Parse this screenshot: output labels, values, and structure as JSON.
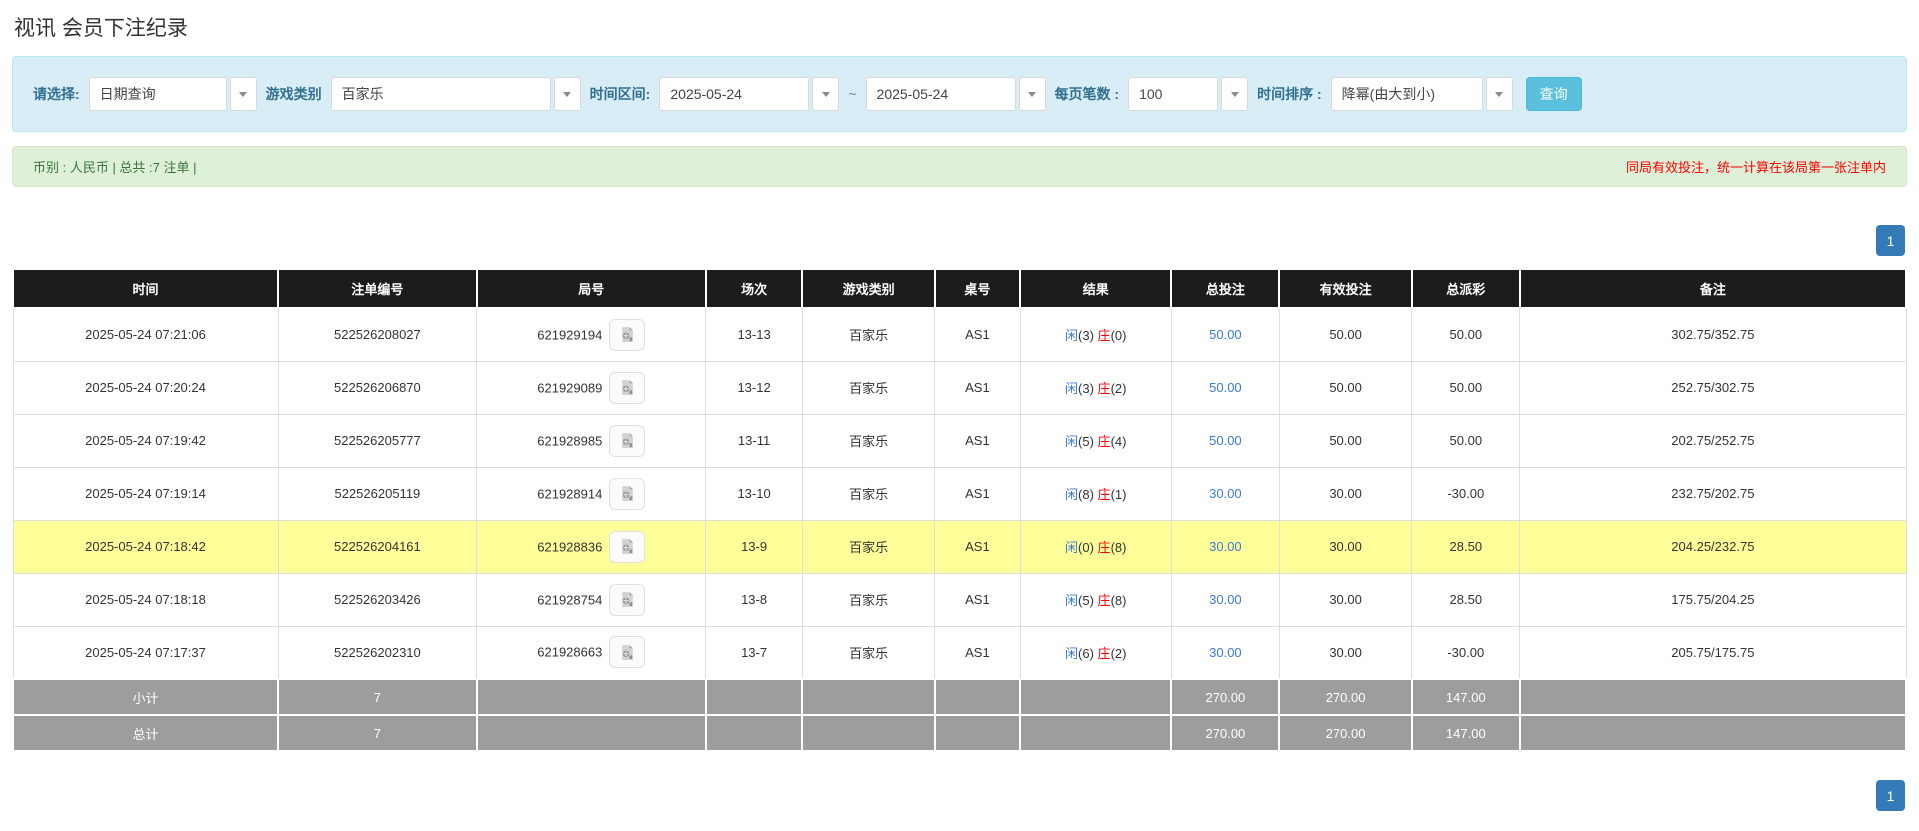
{
  "page": {
    "title": "视讯 会员下注纪录"
  },
  "filters": {
    "query_type": {
      "label": "请选择:",
      "value": "日期查询"
    },
    "game_category": {
      "label": "游戏类别",
      "value": "百家乐"
    },
    "date_range": {
      "label": "时间区间:",
      "from": "2025-05-24",
      "separator": "~",
      "to": "2025-05-24"
    },
    "page_size": {
      "label": "每页笔数 :",
      "value": "100"
    },
    "time_sort": {
      "label": "时间排序 :",
      "value": "降幂(由大到小)"
    },
    "query_button": "查询"
  },
  "summary": {
    "left_text": "币别 : 人民币 | 总共 :7 注单 |",
    "notice": "同局有效投注，统一计算在该局第一张注单内"
  },
  "pagination": {
    "current": "1"
  },
  "table": {
    "headers": [
      "时间",
      "注单编号",
      "局号",
      "场次",
      "游戏类别",
      "桌号",
      "结果",
      "总投注",
      "有效投注",
      "总派彩",
      "备注"
    ],
    "result_labels": {
      "player": "闲",
      "banker": "庄"
    },
    "rows": [
      {
        "time": "2025-05-24 07:21:06",
        "bet_no": "522526208027",
        "round_no": "621929194",
        "session": "13-13",
        "game": "百家乐",
        "table_no": "AS1",
        "player": "3",
        "banker": "0",
        "total_bet": "50.00",
        "valid_bet": "50.00",
        "payout": "50.00",
        "remark": "302.75/352.75",
        "highlighted": false
      },
      {
        "time": "2025-05-24 07:20:24",
        "bet_no": "522526206870",
        "round_no": "621929089",
        "session": "13-12",
        "game": "百家乐",
        "table_no": "AS1",
        "player": "3",
        "banker": "2",
        "total_bet": "50.00",
        "valid_bet": "50.00",
        "payout": "50.00",
        "remark": "252.75/302.75",
        "highlighted": false
      },
      {
        "time": "2025-05-24 07:19:42",
        "bet_no": "522526205777",
        "round_no": "621928985",
        "session": "13-11",
        "game": "百家乐",
        "table_no": "AS1",
        "player": "5",
        "banker": "4",
        "total_bet": "50.00",
        "valid_bet": "50.00",
        "payout": "50.00",
        "remark": "202.75/252.75",
        "highlighted": false
      },
      {
        "time": "2025-05-24 07:19:14",
        "bet_no": "522526205119",
        "round_no": "621928914",
        "session": "13-10",
        "game": "百家乐",
        "table_no": "AS1",
        "player": "8",
        "banker": "1",
        "total_bet": "30.00",
        "valid_bet": "30.00",
        "payout": "-30.00",
        "remark": "232.75/202.75",
        "highlighted": false
      },
      {
        "time": "2025-05-24 07:18:42",
        "bet_no": "522526204161",
        "round_no": "621928836",
        "session": "13-9",
        "game": "百家乐",
        "table_no": "AS1",
        "player": "0",
        "banker": "8",
        "total_bet": "30.00",
        "valid_bet": "30.00",
        "payout": "28.50",
        "remark": "204.25/232.75",
        "highlighted": true
      },
      {
        "time": "2025-05-24 07:18:18",
        "bet_no": "522526203426",
        "round_no": "621928754",
        "session": "13-8",
        "game": "百家乐",
        "table_no": "AS1",
        "player": "5",
        "banker": "8",
        "total_bet": "30.00",
        "valid_bet": "30.00",
        "payout": "28.50",
        "remark": "175.75/204.25",
        "highlighted": false
      },
      {
        "time": "2025-05-24 07:17:37",
        "bet_no": "522526202310",
        "round_no": "621928663",
        "session": "13-7",
        "game": "百家乐",
        "table_no": "AS1",
        "player": "6",
        "banker": "2",
        "total_bet": "30.00",
        "valid_bet": "30.00",
        "payout": "-30.00",
        "remark": "205.75/175.75",
        "highlighted": false
      }
    ],
    "footer_rows": [
      {
        "label": "小计",
        "count": "7",
        "total_bet": "270.00",
        "valid_bet": "270.00",
        "payout": "147.00"
      },
      {
        "label": "总计",
        "count": "7",
        "total_bet": "270.00",
        "valid_bet": "270.00",
        "payout": "147.00"
      }
    ]
  },
  "colors": {
    "panel_bg": "#d9edf7",
    "panel_border": "#bce8f1",
    "label_text": "#31708f",
    "button_bg": "#5bc0de",
    "button_border": "#46b8da",
    "summary_bg": "#dff0d8",
    "summary_border": "#d6e9c6",
    "summary_text": "#3c763d",
    "notice_text": "#ff0000",
    "header_bg": "#1c1c1c",
    "header_text": "#ffffff",
    "link_blue": "#3a7ad9",
    "player_blue": "#3a7ad9",
    "banker_red": "#ff0000",
    "negative_red": "#ff0000",
    "highlight_yellow": "#ffff99",
    "footer_bg": "#9d9d9d",
    "page_active_bg": "#337ab7",
    "row_border": "#dddddd"
  }
}
